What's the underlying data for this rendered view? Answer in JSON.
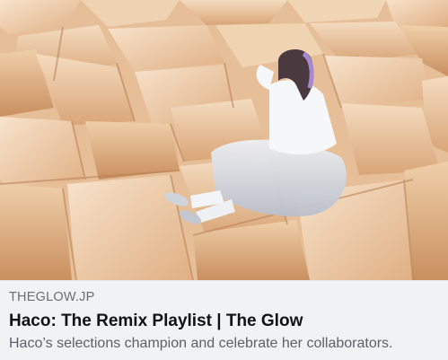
{
  "link_preview": {
    "image_alt": "",
    "domain": "THEGLOW.JP",
    "title": "Haco: The Remix Playlist | The Glow",
    "description": "Haco’s selections champion and celebrate her collaborators."
  },
  "colors": {
    "card_background": "#f1f2f4",
    "title_text": "#111214",
    "secondary_text": "#5d6066"
  }
}
